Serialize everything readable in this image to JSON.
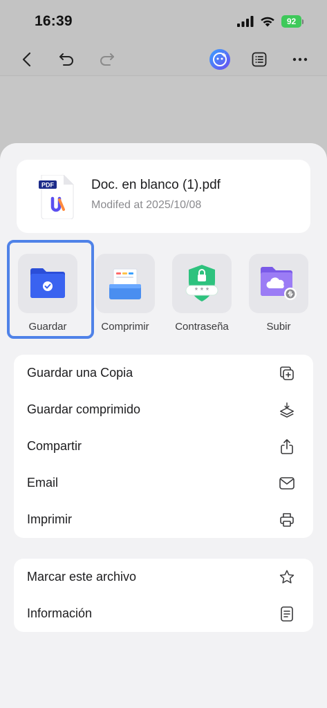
{
  "status_bar": {
    "time": "16:39",
    "battery": "92"
  },
  "toolbar": {
    "back_icon": "chevron-left-icon",
    "undo_icon": "undo-icon",
    "redo_icon": "redo-icon",
    "ai_icon": "ai-assistant-icon",
    "outline_icon": "list-icon",
    "more_icon": "more-icon"
  },
  "file": {
    "name": "Doc. en blanco (1).pdf",
    "modified": "Modifed at 2025/10/08",
    "badge": "PDF"
  },
  "actions": [
    {
      "label": "Guardar",
      "icon": "save-folder-icon"
    },
    {
      "label": "Comprimir",
      "icon": "compress-icon"
    },
    {
      "label": "Contraseña",
      "icon": "password-shield-icon"
    },
    {
      "label": "Subir",
      "icon": "cloud-upload-folder-icon"
    }
  ],
  "menu_primary": [
    {
      "label": "Guardar una Copia",
      "icon": "copy-add-icon"
    },
    {
      "label": "Guardar comprimido",
      "icon": "compress-layers-icon"
    },
    {
      "label": "Compartir",
      "icon": "share-icon"
    },
    {
      "label": "Email",
      "icon": "mail-icon"
    },
    {
      "label": "Imprimir",
      "icon": "printer-icon"
    }
  ],
  "menu_secondary": [
    {
      "label": "Marcar este archivo",
      "icon": "star-icon"
    },
    {
      "label": "Información",
      "icon": "info-document-icon"
    }
  ],
  "colors": {
    "accent": "#4f82e8",
    "battery": "#3ec95a",
    "sheet_background": "#f2f2f4"
  }
}
